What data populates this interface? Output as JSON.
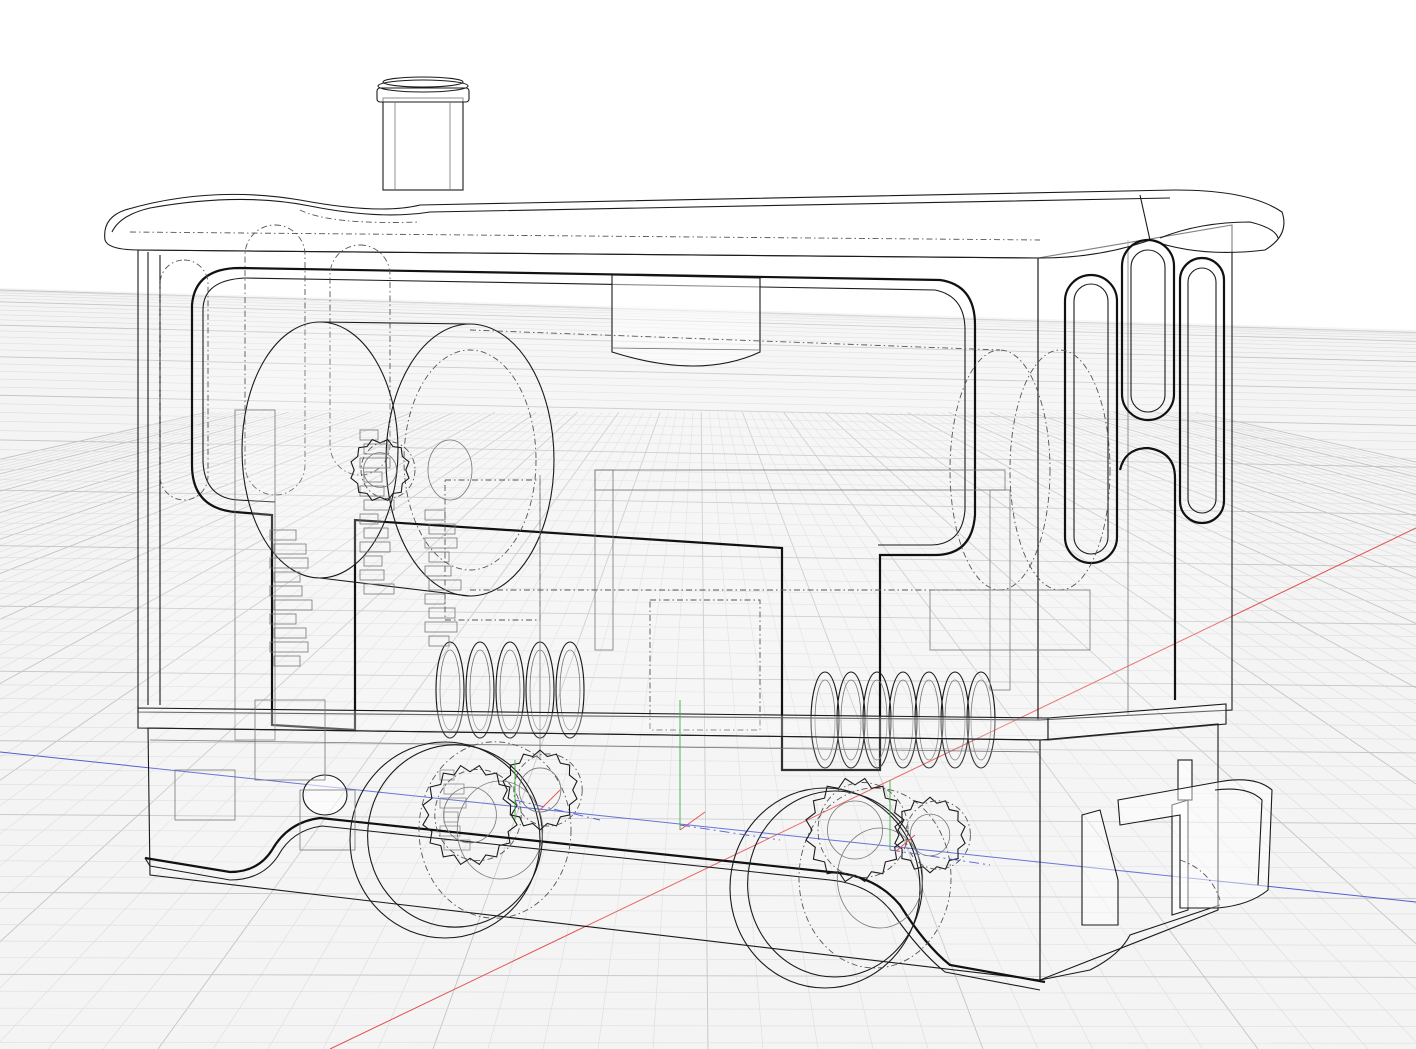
{
  "viewport": {
    "background": "#ffffff",
    "grid_floor": "#f4f4f4",
    "grid_minor": "#dcdcdc",
    "grid_major": "#c4c4c4",
    "axis_x_color": "#e05050",
    "axis_y_color": "#40b040",
    "axis_z_color": "#5060d0",
    "display_mode": "x-ray wireframe",
    "line_color": "#111111"
  },
  "model": {
    "subject": "tank-engine",
    "icons": {
      "chimney": "chimney-icon",
      "cab_roof": "cab-roof-icon",
      "boiler": "boiler-icon",
      "front_wheel": "wheel-icon",
      "rear_wheel": "wheel-icon",
      "gear": "gear-icon",
      "coupler": "coupler-icon"
    }
  }
}
